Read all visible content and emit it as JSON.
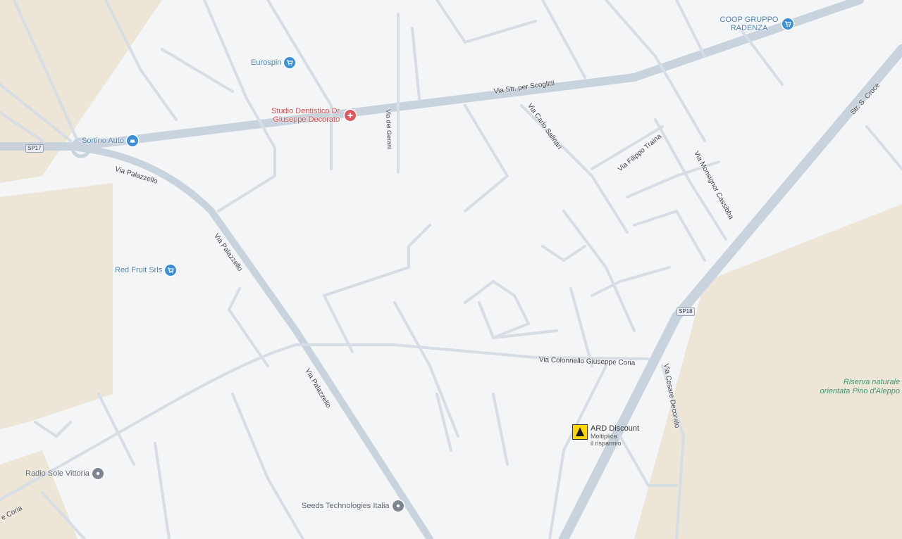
{
  "map": {
    "colors": {
      "background": "#f4f5f7",
      "road": "#d6dde5",
      "major_road": "#c9d3dd",
      "terrain": "#ede5d6",
      "park_text": "#3d9a6e"
    },
    "road_labels": {
      "scoglitti": "Via Str. per Scoglitti",
      "palazzello_1": "Via Palazzello",
      "palazzello_2": "Via Palazzello",
      "palazzello_3": "Via Palazzello",
      "carlo_salinari": "Via Carlo Salinari",
      "filippo_traina": "Via Filippo Traina",
      "monsignor": "Via Monsignor Cassibba",
      "croce": "Str. S. Croce",
      "colonnello": "Via Colonnello Giuseppe Coria",
      "cesare": "Via Cesare Decorato",
      "gerani": "Via dei Gerani",
      "coria_left": "e Coria"
    },
    "shields": {
      "sp17": "SP17",
      "sp18": "SP18"
    },
    "pois": {
      "coop": {
        "label": "COOP GRUPPO\nRADENZA",
        "icon": "shopping-cart-icon"
      },
      "eurospin": {
        "label": "Eurospin",
        "icon": "shopping-cart-icon"
      },
      "studio": {
        "label": "Studio Dentistico Dr.\nGiuseppe Decorato",
        "icon": "medical-icon"
      },
      "sortino": {
        "label": "Sortino Auto",
        "icon": "car-icon"
      },
      "redfruit": {
        "label": "Red Fruit Srls",
        "icon": "shopping-cart-icon"
      },
      "radio": {
        "label": "Radio Sole Vittoria",
        "icon": "location-pin-icon"
      },
      "seeds": {
        "label": "Seeds Technologies Italia",
        "icon": "location-pin-icon"
      }
    },
    "ard": {
      "name": "ARD Discount",
      "sub1": "Moltiplica",
      "sub2": "il risparmio"
    },
    "park": {
      "line1": "Riserva naturale",
      "line2": "orientata Pino d'Aleppo"
    }
  }
}
